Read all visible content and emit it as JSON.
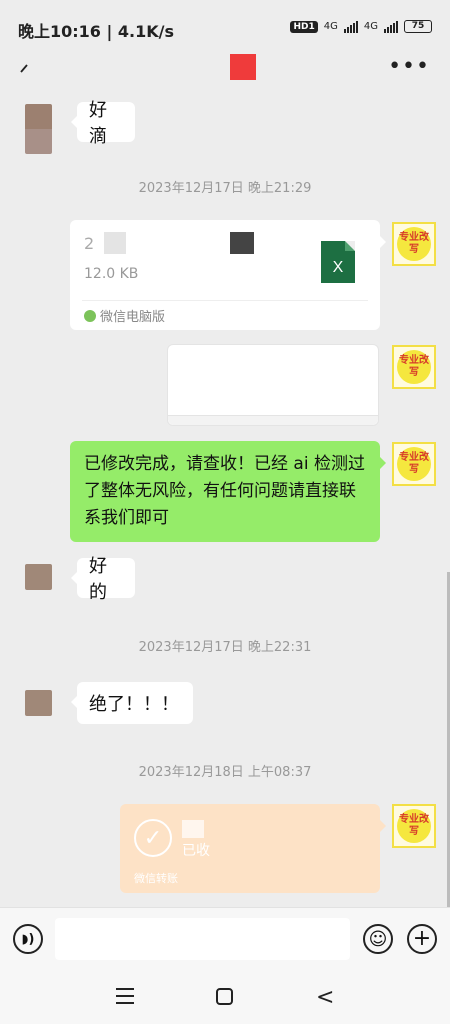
{
  "status_bar": {
    "time_speed": "晚上10:16 | 4.1K/s",
    "hd_badge": "HD1",
    "net1": "4G",
    "net2": "4G",
    "battery": "75"
  },
  "messages": {
    "m1_text": "好滴",
    "ts1": "2023年12月17日 晚上21:29",
    "file": {
      "name_fragment": "2",
      "size": "12.0 KB",
      "source": "微信电脑版",
      "icon_letter": "X"
    },
    "green_text": "已修改完成，请查收！已经 ai 检测过了整体无风险，有任何问题请直接联系我们即可",
    "m2_text": "好的",
    "ts2": "2023年12月17日 晚上22:31",
    "m3_text": "绝了！！！",
    "ts3": "2023年12月18日 上午08:37",
    "transfer": {
      "status": "已收",
      "label": "微信转账"
    },
    "my_avatar_text": "专业改写"
  },
  "input_bar": {
    "placeholder": ""
  },
  "colors": {
    "green_bubble": "#95ec69",
    "transfer_bubble": "#fde2c6",
    "chat_bg": "#ededed"
  }
}
